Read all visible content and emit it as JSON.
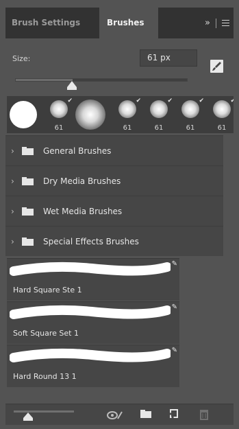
{
  "tabs": [
    {
      "label": "Brush Settings",
      "active": false
    },
    {
      "label": "Brushes",
      "active": true
    }
  ],
  "tab_tools": {
    "overflow": "»",
    "menu_icon": "hamburger-menu-icon"
  },
  "size": {
    "label": "Size:",
    "value": "61 px",
    "slider_fraction": 0.33
  },
  "presets": [
    {
      "kind": "hard-round",
      "number": ""
    },
    {
      "kind": "soft-round-small",
      "number": "61"
    },
    {
      "kind": "soft-round",
      "number": ""
    },
    {
      "kind": "soft-round-small",
      "number": "61"
    },
    {
      "kind": "soft-round-small",
      "number": "61"
    },
    {
      "kind": "soft-round-small",
      "number": "61"
    },
    {
      "kind": "soft-round-small",
      "number": "61"
    }
  ],
  "groups": [
    {
      "label": "General Brushes"
    },
    {
      "label": "Dry Media Brushes"
    },
    {
      "label": "Wet Media Brushes"
    },
    {
      "label": "Special Effects Brushes"
    }
  ],
  "brushes": [
    {
      "name": "Hard Square Ste 1"
    },
    {
      "name": "Soft Square Set 1"
    },
    {
      "name": "Hard Round 13 1"
    }
  ],
  "footer": {
    "icons": [
      "eye-pressure-icon",
      "new-group-folder-icon",
      "new-brush-icon",
      "trash-icon"
    ],
    "preview_slider_fraction": 0.3
  },
  "colors": {
    "panel_bg": "#535353",
    "tab_bar": "#323232",
    "row_bg": "#464646",
    "text": "#e6e6e6"
  }
}
